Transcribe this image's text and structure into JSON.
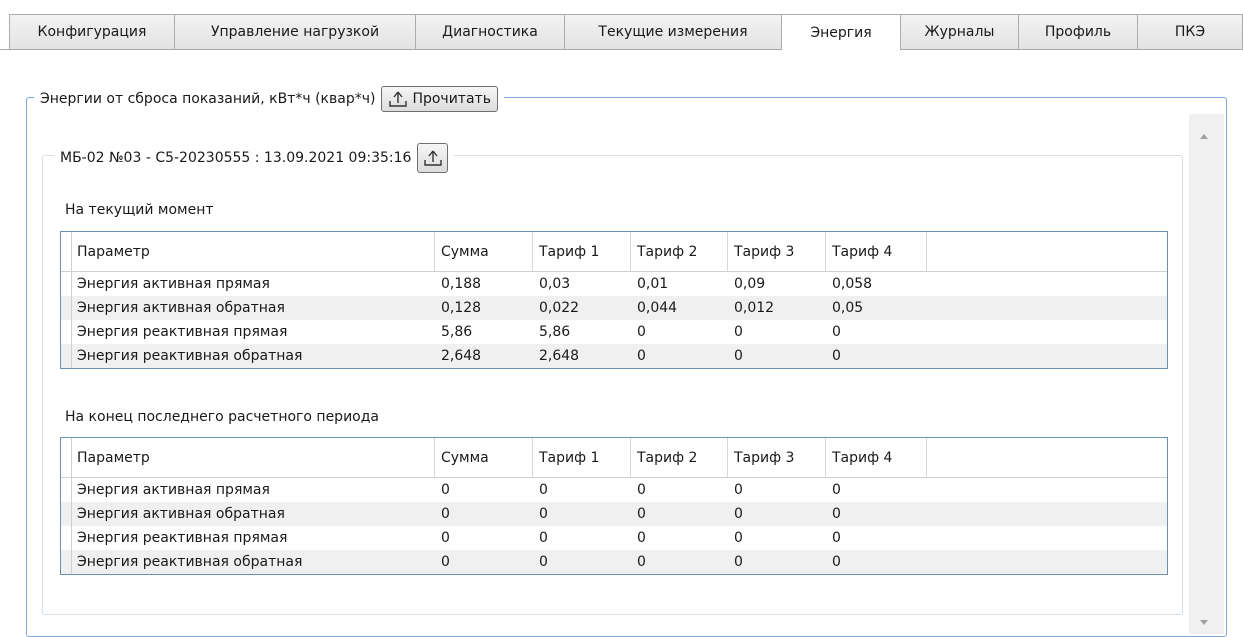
{
  "tabs": [
    {
      "label": "Конфигурация",
      "active": false
    },
    {
      "label": "Управление нагрузкой",
      "active": false
    },
    {
      "label": "Диагностика",
      "active": false
    },
    {
      "label": "Текущие измерения",
      "active": false
    },
    {
      "label": "Энергия",
      "active": true
    },
    {
      "label": "Журналы",
      "active": false
    },
    {
      "label": "Профиль",
      "active": false
    },
    {
      "label": "ПКЭ",
      "active": false
    }
  ],
  "energy_group": {
    "title": "Энергии от сброса показаний, кВт*ч (квар*ч)",
    "read_button": "Прочитать"
  },
  "device": {
    "title": "МБ-02 №03 - С5-20230555 : 13.09.2021 09:35:16"
  },
  "columns": [
    "Параметр",
    "Сумма",
    "Тариф 1",
    "Тариф 2",
    "Тариф 3",
    "Тариф 4"
  ],
  "current": {
    "title": "На текущий момент",
    "rows": [
      [
        "Энергия активная прямая",
        "0,188",
        "0,03",
        "0,01",
        "0,09",
        "0,058"
      ],
      [
        "Энергия активная обратная",
        "0,128",
        "0,022",
        "0,044",
        "0,012",
        "0,05"
      ],
      [
        "Энергия реактивная прямая",
        "5,86",
        "5,86",
        "0",
        "0",
        "0"
      ],
      [
        "Энергия реактивная обратная",
        "2,648",
        "2,648",
        "0",
        "0",
        "0"
      ]
    ]
  },
  "period_end": {
    "title": "На конец последнего расчетного периода",
    "rows": [
      [
        "Энергия активная прямая",
        "0",
        "0",
        "0",
        "0",
        "0"
      ],
      [
        "Энергия активная обратная",
        "0",
        "0",
        "0",
        "0",
        "0"
      ],
      [
        "Энергия реактивная прямая",
        "0",
        "0",
        "0",
        "0",
        "0"
      ],
      [
        "Энергия реактивная обратная",
        "0",
        "0",
        "0",
        "0",
        "0"
      ]
    ]
  },
  "icons": {
    "read": "upload-icon",
    "device_read": "upload-icon"
  },
  "colors": {
    "group_border": "#7fa6d8",
    "grid_border": "#6d8fb6",
    "alt_row": "#f0f0f0"
  }
}
